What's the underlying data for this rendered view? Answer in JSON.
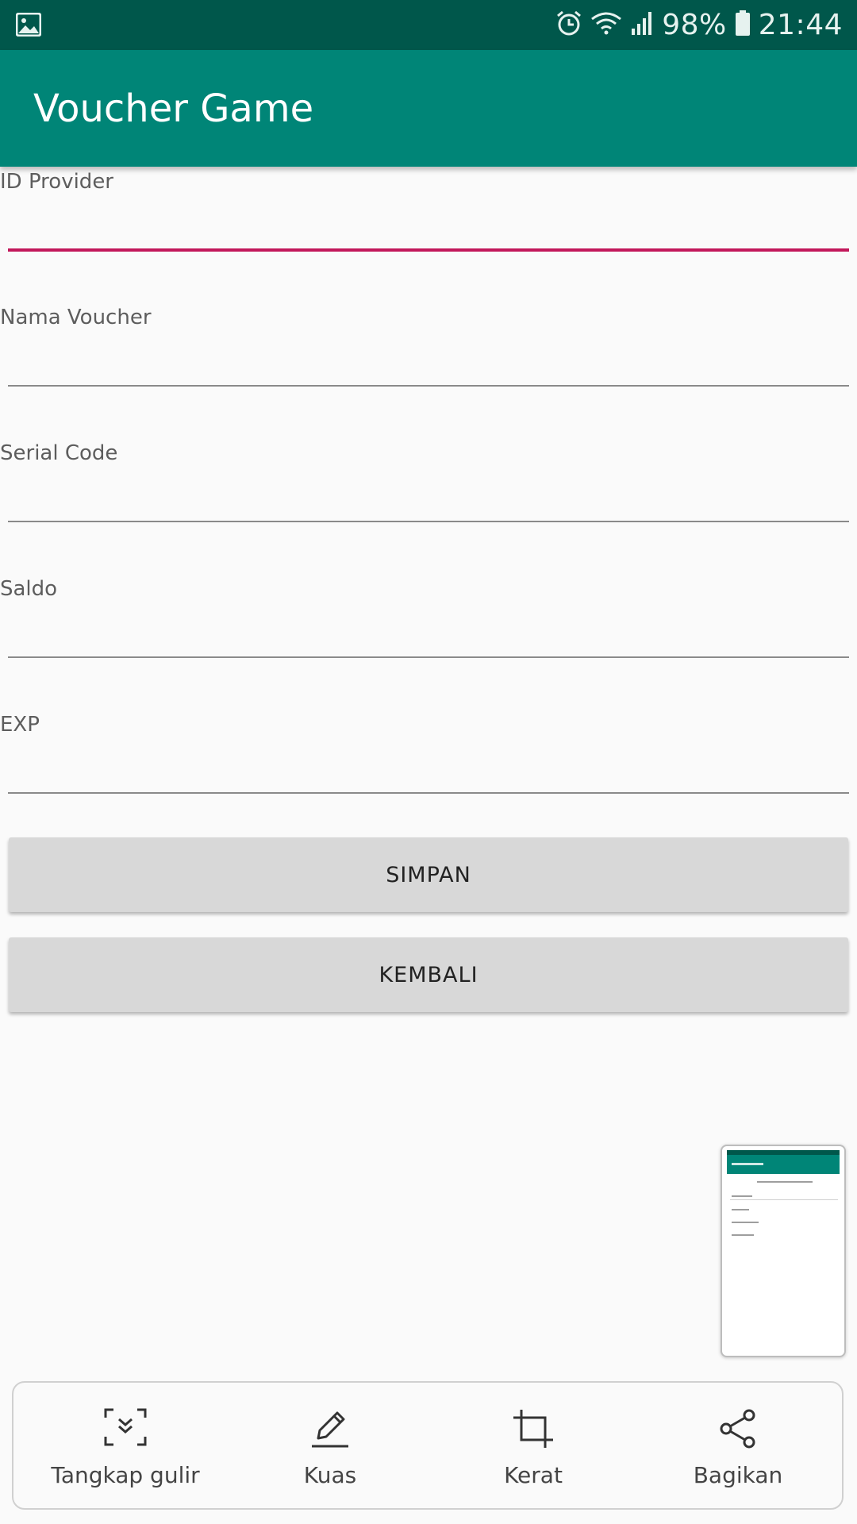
{
  "status_bar": {
    "battery_percent": "98%",
    "time": "21:44",
    "icons": [
      "gallery-icon",
      "alarm-icon",
      "wifi-icon",
      "signal-icon",
      "battery-icon"
    ]
  },
  "app_bar": {
    "title": "Voucher Game"
  },
  "form": {
    "fields": [
      {
        "label": "ID Provider",
        "value": "",
        "focused": true
      },
      {
        "label": "Nama Voucher",
        "value": ""
      },
      {
        "label": "Serial Code",
        "value": ""
      },
      {
        "label": "Saldo",
        "value": ""
      },
      {
        "label": "EXP",
        "value": ""
      }
    ]
  },
  "buttons": {
    "save_label": "SIMPAN",
    "back_label": "KEMBALI"
  },
  "screenshot_toolbar": {
    "items": [
      {
        "label": "Tangkap gulir",
        "icon": "scroll-capture-icon"
      },
      {
        "label": "Kuas",
        "icon": "brush-icon"
      },
      {
        "label": "Kerat",
        "icon": "crop-icon"
      },
      {
        "label": "Bagikan",
        "icon": "share-icon"
      }
    ]
  },
  "colors": {
    "status_bar": "#00574b",
    "app_bar": "#008577",
    "accent": "#c2185b",
    "button": "#d8d8d8",
    "background": "#fafafa"
  }
}
